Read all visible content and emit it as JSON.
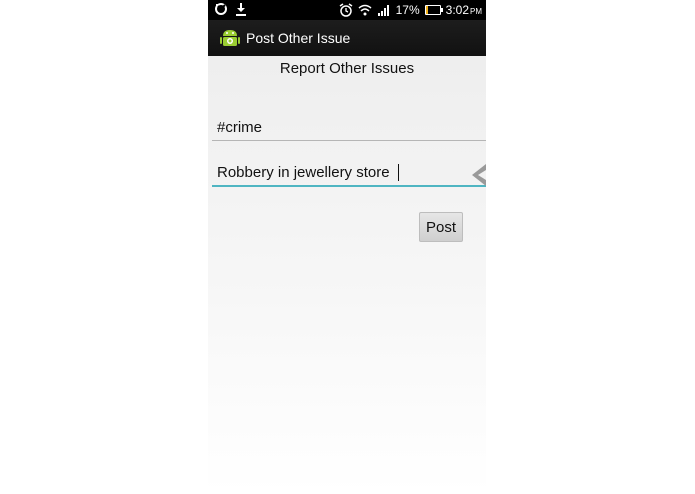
{
  "status_bar": {
    "battery_percent": "17%",
    "battery_level": 0.17,
    "time": "3:02",
    "ampm": "PM",
    "icons": [
      "sync-icon",
      "download-icon",
      "alarm-icon",
      "wifi-icon",
      "signal-icon",
      "battery-icon"
    ]
  },
  "action_bar": {
    "title": "Post Other Issue",
    "icon": "android-icon"
  },
  "form": {
    "heading": "Report Other Issues",
    "hashtag_value": "#crime",
    "description_value": "Robbery in jewellery store",
    "post_label": "Post"
  },
  "colors": {
    "action_bar_bg": "#151515",
    "focus_underline": "#4fb5c2",
    "battery_fill": "#f2b21b"
  }
}
